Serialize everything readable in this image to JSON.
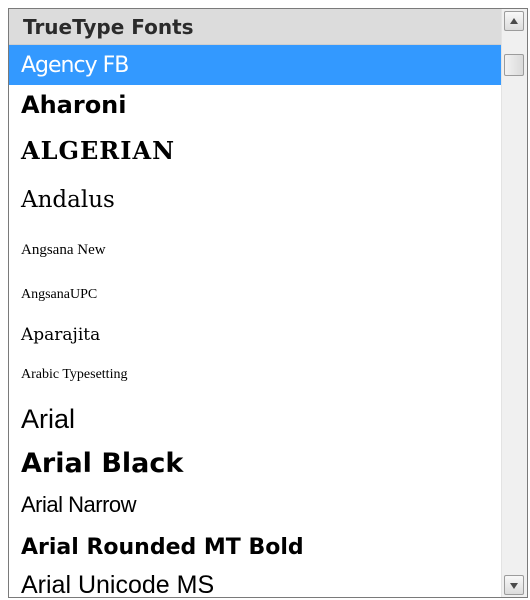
{
  "header": {
    "title": "TrueType Fonts"
  },
  "fonts": [
    {
      "label": "Agency FB",
      "selected": true
    },
    {
      "label": "Aharoni"
    },
    {
      "label": "ALGERIAN"
    },
    {
      "label": "Andalus"
    },
    {
      "label": "Angsana New"
    },
    {
      "label": "AngsanaUPC"
    },
    {
      "label": "Aparajita"
    },
    {
      "label": "Arabic Typesetting"
    },
    {
      "label": "Arial"
    },
    {
      "label": "Arial Black"
    },
    {
      "label": "Arial Narrow"
    },
    {
      "label": "Arial Rounded MT Bold"
    },
    {
      "label": "Arial Unicode MS"
    }
  ],
  "colors": {
    "selection": "#3399ff",
    "header_bg": "#dcdcdc"
  },
  "scrollbar": {
    "up_icon": "scroll-up-arrow",
    "down_icon": "scroll-down-arrow"
  }
}
